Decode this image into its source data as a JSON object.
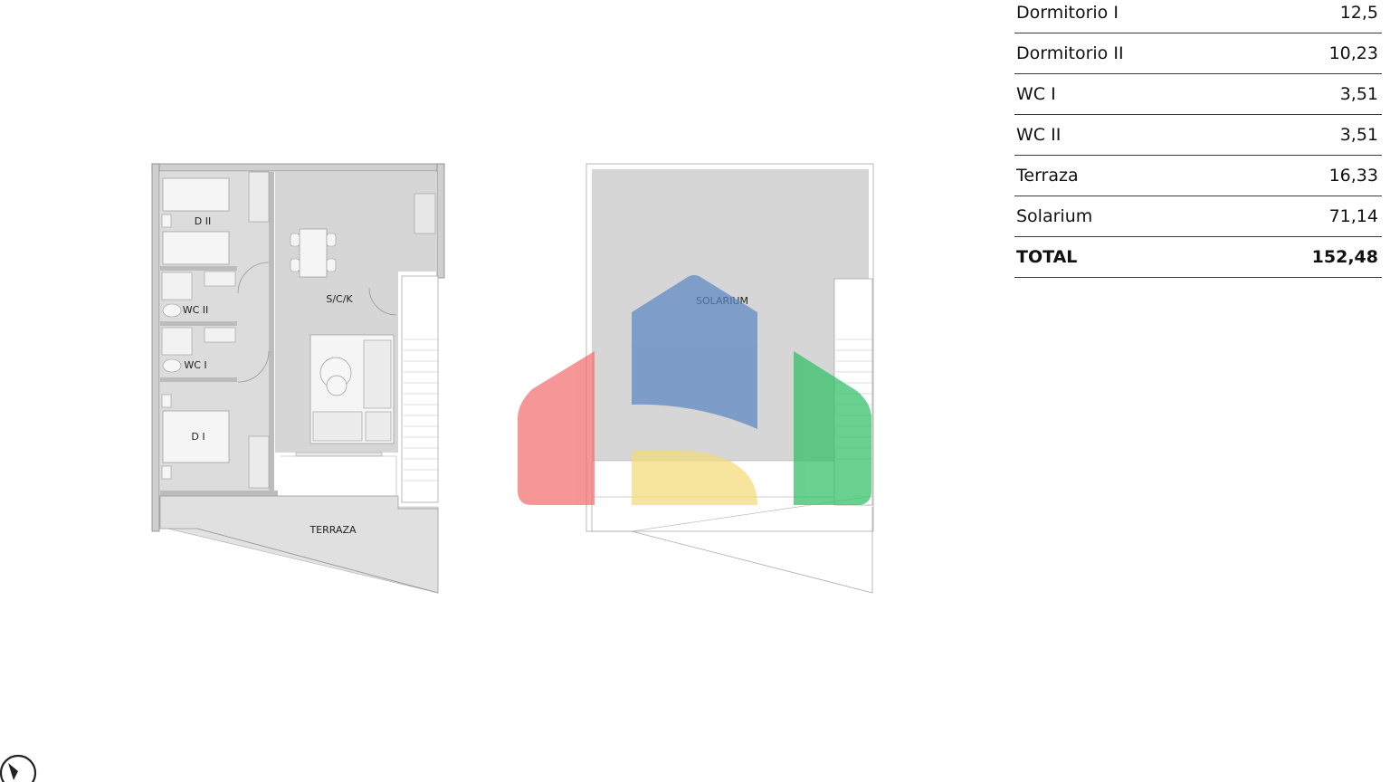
{
  "plan_labels": {
    "d2": "D II",
    "wc2": "WC II",
    "wc1": "WC I",
    "d1": "D I",
    "sck": "S/C/K",
    "terraza": "TERRAZA",
    "solarium": "SOLARIUM"
  },
  "areas": [
    {
      "name": "Dormitorio I",
      "value": "12,5"
    },
    {
      "name": "Dormitorio II",
      "value": "10,23"
    },
    {
      "name": "WC I",
      "value": "3,51"
    },
    {
      "name": "WC II",
      "value": "3,51"
    },
    {
      "name": "Terraza",
      "value": "16,33"
    },
    {
      "name": "Solarium",
      "value": "71,14"
    }
  ],
  "total": {
    "name": "TOTAL",
    "value": "152,48"
  },
  "watermark_colors": {
    "red": "#f26d6d",
    "blue": "#5c86c4",
    "yellow": "#f4dc7a",
    "green": "#2fbf64"
  },
  "icons": {
    "compass": "north-arrow-icon"
  }
}
